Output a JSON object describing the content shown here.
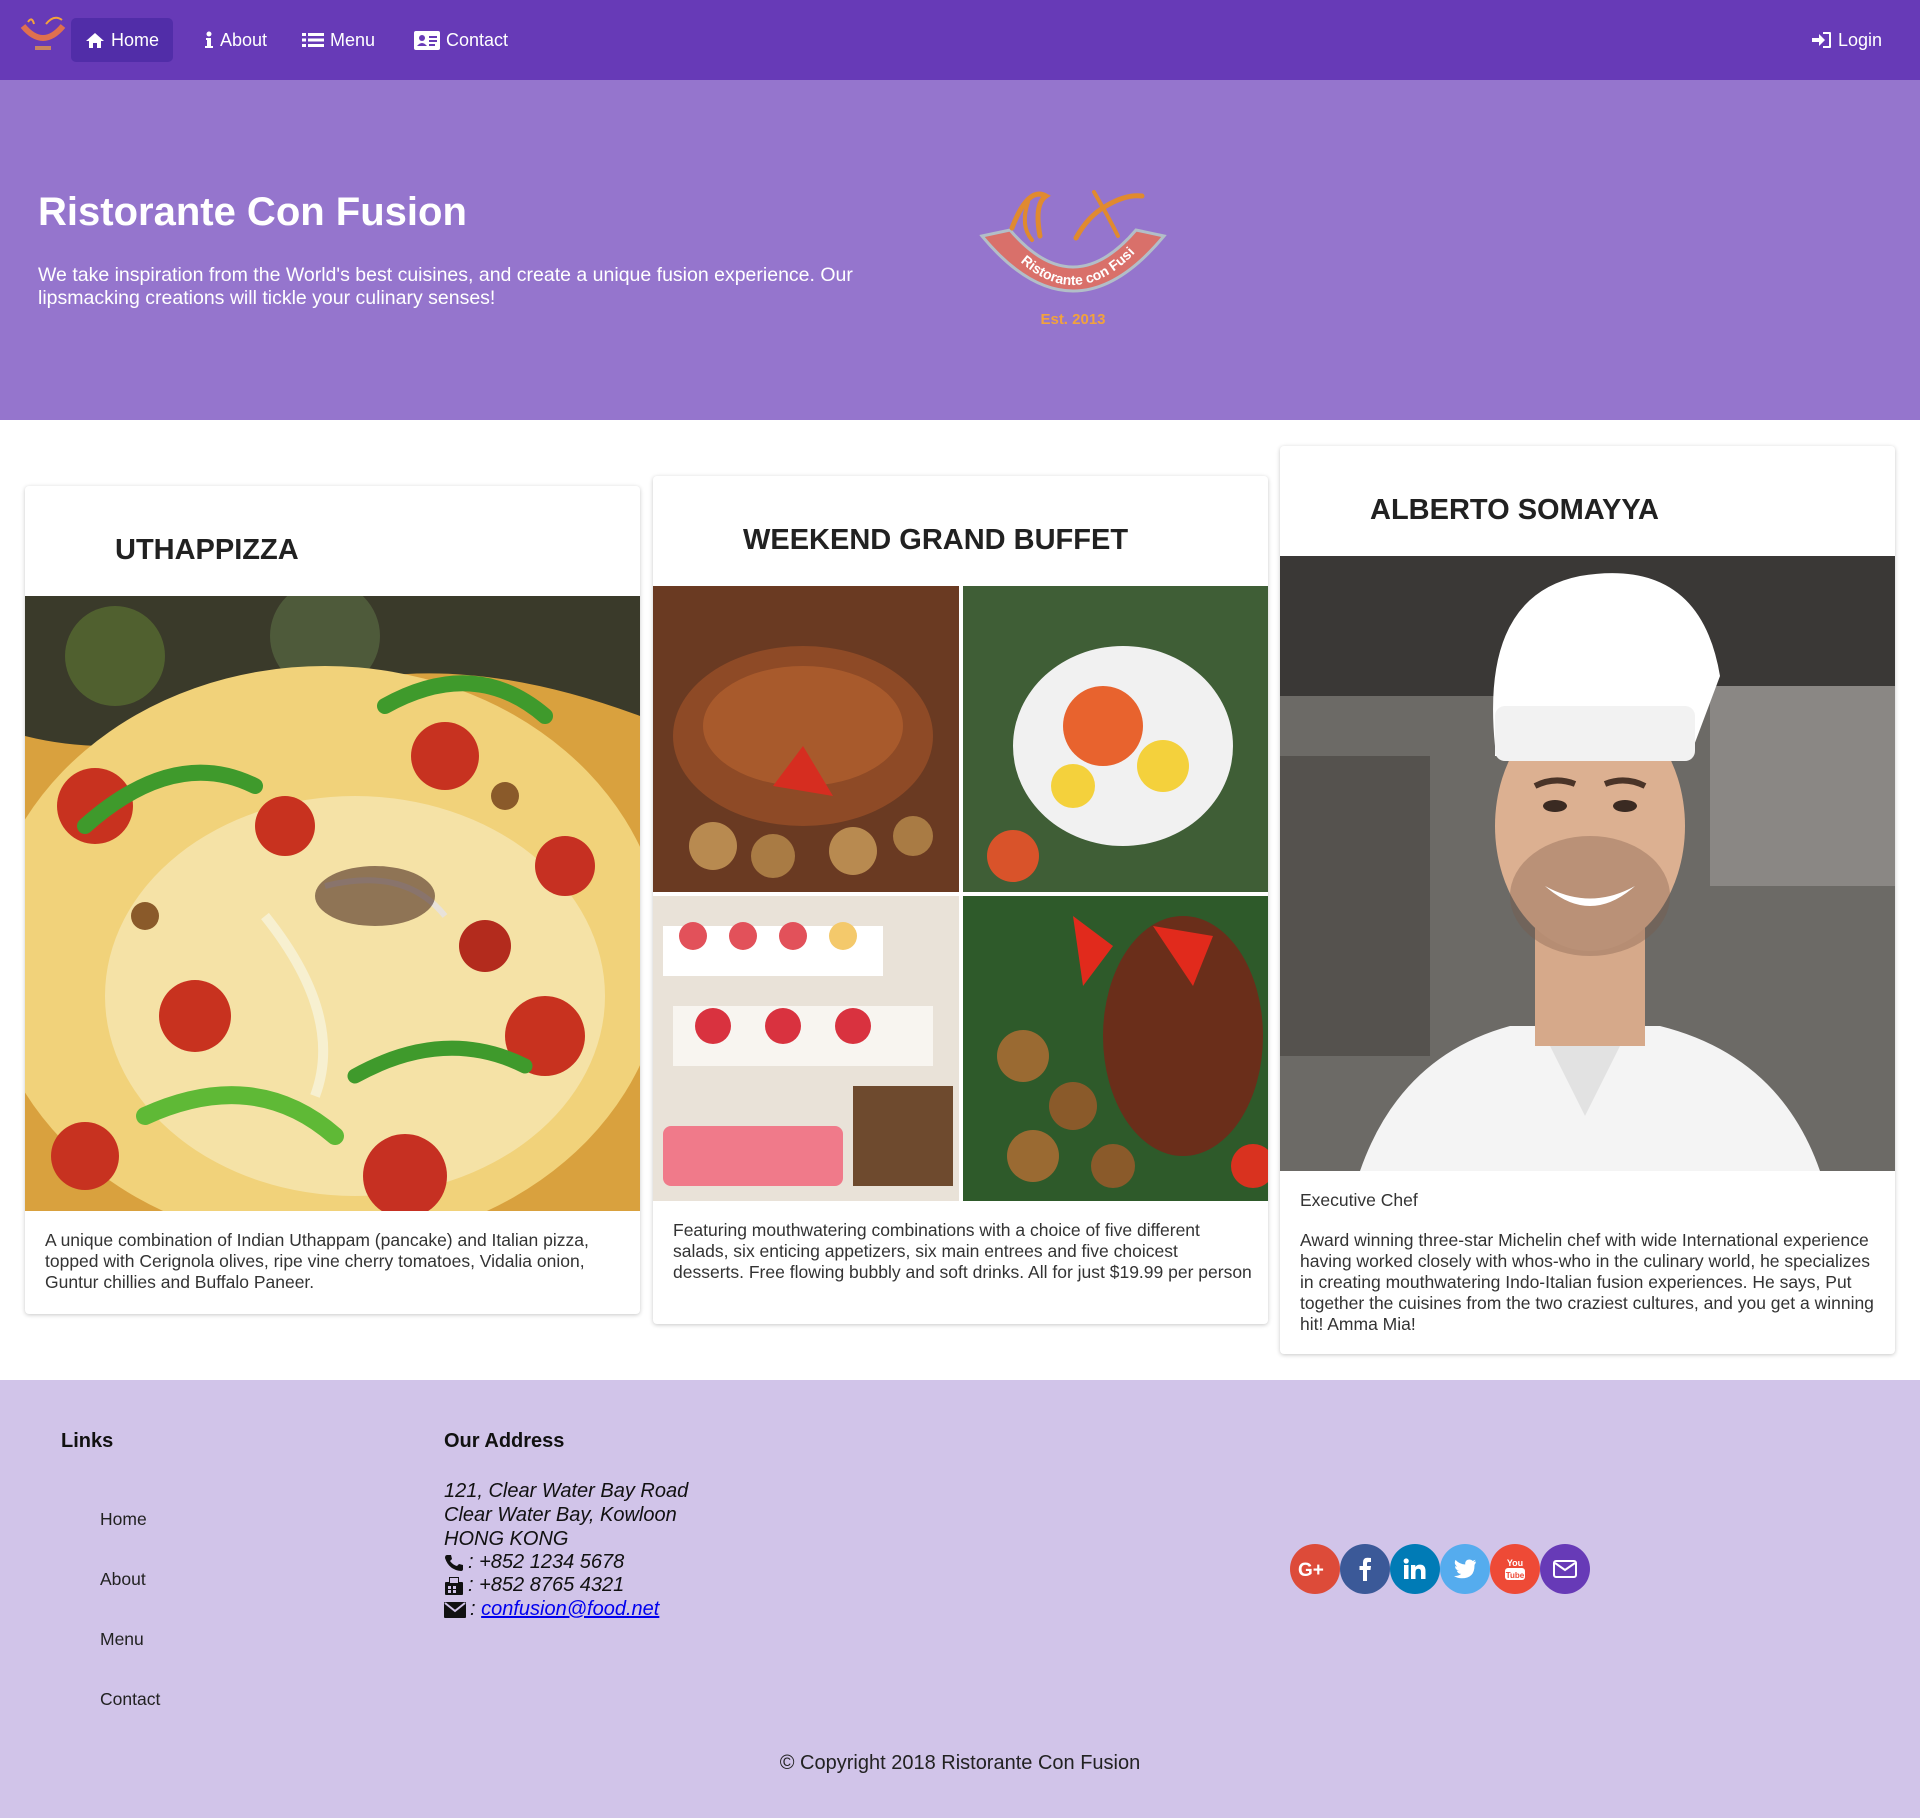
{
  "nav": {
    "items": [
      {
        "label": "Home",
        "icon": "home-icon",
        "active": true
      },
      {
        "label": "About",
        "icon": "info-icon"
      },
      {
        "label": "Menu",
        "icon": "list-icon"
      },
      {
        "label": "Contact",
        "icon": "address-card-icon"
      }
    ],
    "login_label": "Login"
  },
  "hero": {
    "title": "Ristorante Con Fusion",
    "description": "We take inspiration from the World's best cuisines, and create a unique fusion experience. Our lipsmacking creations will tickle your culinary senses!",
    "logo_text": "Ristorante con Fusion",
    "logo_year": "Est. 2013"
  },
  "cards": [
    {
      "title": "UTHAPPIZZA",
      "image": "pizza photo",
      "text": "A unique combination of Indian Uthappam (pancake) and Italian pizza, topped with Cerignola olives, ripe vine cherry tomatoes, Vidalia onion, Guntur chillies and Buffalo Paneer."
    },
    {
      "title": "WEEKEND GRAND BUFFET",
      "image": "buffet collage photo",
      "text": "Featuring mouthwatering combinations with a choice of five different salads, six enticing appetizers, six main entrees and five choicest desserts. Free flowing bubbly and soft drinks. All for just $19.99 per person"
    },
    {
      "title": "ALBERTO SOMAYYA",
      "image": "chef portrait photo",
      "subtitle": "Executive Chef",
      "text": "Award winning three-star Michelin chef with wide International experience having worked closely with whos-who in the culinary world, he specializes in creating mouthwatering Indo-Italian fusion experiences. He says, Put together the cuisines from the two craziest cultures, and you get a winning hit! Amma Mia!"
    }
  ],
  "footer": {
    "links_heading": "Links",
    "links": [
      "Home",
      "About",
      "Menu",
      "Contact"
    ],
    "address_heading": "Our Address",
    "address_lines": [
      "121, Clear Water Bay Road",
      "Clear Water Bay, Kowloon",
      "HONG KONG"
    ],
    "phone": ": +852 1234 5678",
    "fax": ": +852 8765 4321",
    "email": "confusion@food.net",
    "social": [
      {
        "name": "google-plus",
        "color": "#dd4b39"
      },
      {
        "name": "facebook",
        "color": "#3b5998"
      },
      {
        "name": "linkedin",
        "color": "#007bb6"
      },
      {
        "name": "twitter",
        "color": "#55acee"
      },
      {
        "name": "youtube",
        "color": "#ee4a36"
      },
      {
        "name": "email",
        "color": "#673ab7"
      }
    ],
    "copyright": "© Copyright 2018 Ristorante Con Fusion"
  },
  "colors": {
    "navbar": "#673ab7",
    "nav_active": "#512da8",
    "jumbotron": "#9575cd",
    "footer": "#d1c4e9"
  }
}
